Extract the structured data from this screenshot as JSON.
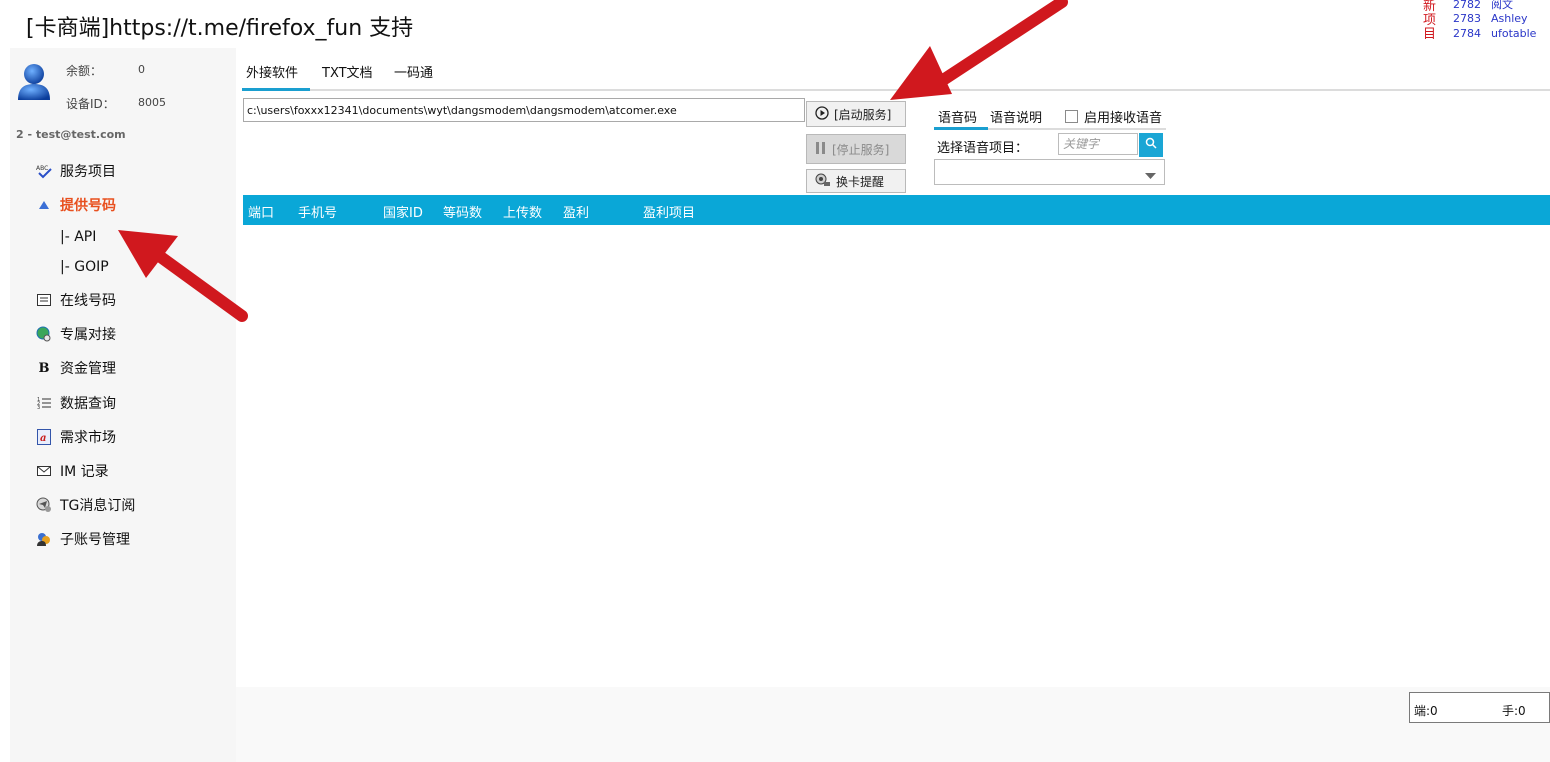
{
  "app": {
    "title": "[卡商端]https://t.me/firefox_fun 支持"
  },
  "news": {
    "label": "新项目",
    "items": [
      {
        "id": "2782",
        "name": "阅文"
      },
      {
        "id": "2783",
        "name": "Ashley"
      },
      {
        "id": "2784",
        "name": "ufotable"
      }
    ]
  },
  "account": {
    "balance_label": "余额：",
    "balance_value": "0",
    "device_label": "设备ID：",
    "device_value": "8005",
    "user": "2 - test@test.com"
  },
  "sidebar": {
    "items": [
      {
        "label": "服务项目",
        "icon": "abc-check-icon"
      },
      {
        "label": "提供号码",
        "icon": "up-triangle-icon",
        "active": true
      },
      {
        "label": "在线号码",
        "icon": "list-box-icon"
      },
      {
        "label": "专属对接",
        "icon": "globe-link-icon"
      },
      {
        "label": "资金管理",
        "icon": "bold-b-icon"
      },
      {
        "label": "数据查询",
        "icon": "numbered-list-icon"
      },
      {
        "label": "需求市场",
        "icon": "a-badge-icon"
      },
      {
        "label": "IM 记录",
        "icon": "envelope-icon"
      },
      {
        "label": "TG消息订阅",
        "icon": "telegram-icon"
      },
      {
        "label": "子账号管理",
        "icon": "users-icon"
      }
    ],
    "sub_items": [
      {
        "label": "|-  API"
      },
      {
        "label": "|-  GOIP"
      }
    ]
  },
  "tabs": [
    {
      "label": "外接软件",
      "active": true
    },
    {
      "label": "TXT文档"
    },
    {
      "label": "一码通"
    }
  ],
  "path": {
    "value": "c:\\users\\foxxx12341\\documents\\wyt\\dangsmodem\\dangsmodem\\atcomer.exe"
  },
  "buttons": {
    "start": "[启动服务]",
    "stop": "[停止服务]",
    "swap": "换卡提醒"
  },
  "voice": {
    "tabs": [
      {
        "label": "语音码",
        "active": true
      },
      {
        "label": "语音说明"
      }
    ],
    "enable_label": "启用接收语音",
    "enable_checked": false,
    "select_label": "选择语音项目：",
    "keyword_placeholder": "关键字",
    "selected": ""
  },
  "table": {
    "columns": [
      "端口",
      "手机号",
      "国家ID",
      "等码数",
      "上传数",
      "盈利",
      "盈利项目"
    ],
    "rows": []
  },
  "status": {
    "ports": "端:0",
    "phones": "手:0"
  },
  "colors": {
    "accent": "#0aa7d7",
    "active_nav": "#e8501f",
    "arrow": "#d0181e",
    "news_label": "#d0181e",
    "news_link": "#2a36c8"
  }
}
